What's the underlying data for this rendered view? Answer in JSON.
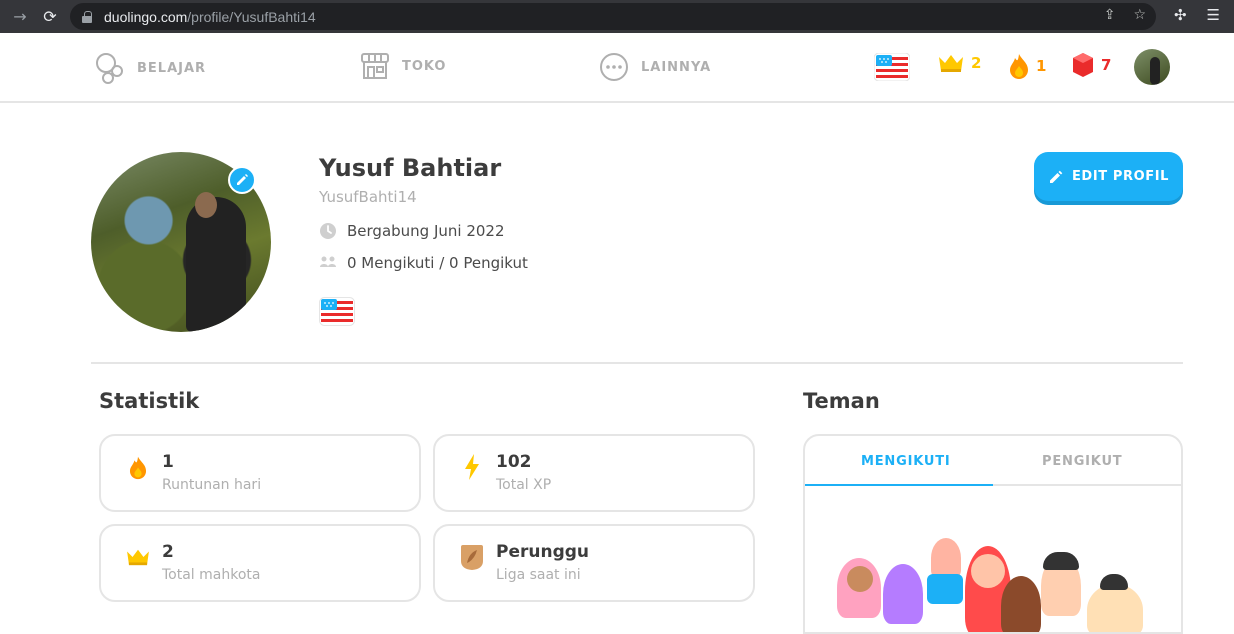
{
  "browser": {
    "url_host": "duolingo.com",
    "url_path": "/profile/YusufBahti14"
  },
  "nav": {
    "items": [
      {
        "label": "BELAJAR",
        "icon": "learn-bubbles-icon"
      },
      {
        "label": "TOKO",
        "icon": "shop-icon"
      },
      {
        "label": "LAINNYA",
        "icon": "more-dots-icon"
      }
    ],
    "crowns": "2",
    "streak": "1",
    "gems": "7",
    "colors": {
      "crown": "#ffc800",
      "streak": "#ff9600",
      "gems": "#ea2b2b",
      "accent": "#1cb0f6"
    }
  },
  "profile": {
    "name": "Yusuf Bahtiar",
    "username": "YusufBahti14",
    "joined": "Bergabung Juni 2022",
    "follow": "0 Mengikuti / 0 Pengikut",
    "edit_label": "EDIT PROFIL"
  },
  "stats": {
    "title": "Statistik",
    "cards": [
      {
        "value": "1",
        "label": "Runtunan hari",
        "icon": "flame-icon"
      },
      {
        "value": "102",
        "label": "Total XP",
        "icon": "lightning-icon"
      },
      {
        "value": "2",
        "label": "Total mahkota",
        "icon": "crown-icon"
      },
      {
        "value": "Perunggu",
        "label": "Liga saat ini",
        "icon": "bronze-league-icon"
      }
    ]
  },
  "friends": {
    "title": "Teman",
    "tab_following": "MENGIKUTI",
    "tab_followers": "PENGIKUT"
  }
}
